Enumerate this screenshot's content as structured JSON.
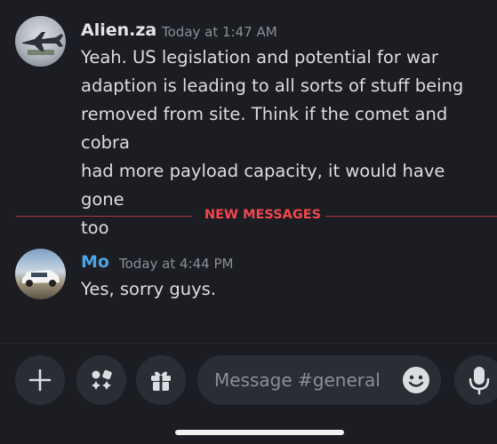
{
  "messages": [
    {
      "author": "Alien.za",
      "timestamp": "Today at 1:47 AM",
      "text": "Yeah. US legislation and potential for war\nadaption is leading to all sorts of stuff being\nremoved from site. Think if the comet and cobra\nhad more payload capacity, it would have gone\ntoo",
      "author_color": "#f2f3f5"
    },
    {
      "author": "Mo",
      "timestamp": "Today at 4:44 PM",
      "text": "Yes, sorry guys.",
      "author_color": "#4fa3e3"
    }
  ],
  "divider": {
    "label": "NEW MESSAGES",
    "color": "#f0474f"
  },
  "composer": {
    "placeholder": "Message #general",
    "buttons": [
      "plus-icon",
      "apps-icon",
      "gift-icon",
      "emoji-icon",
      "microphone-icon"
    ]
  },
  "colors": {
    "background": "#1c1d22",
    "input_bg": "#2b2d34"
  }
}
